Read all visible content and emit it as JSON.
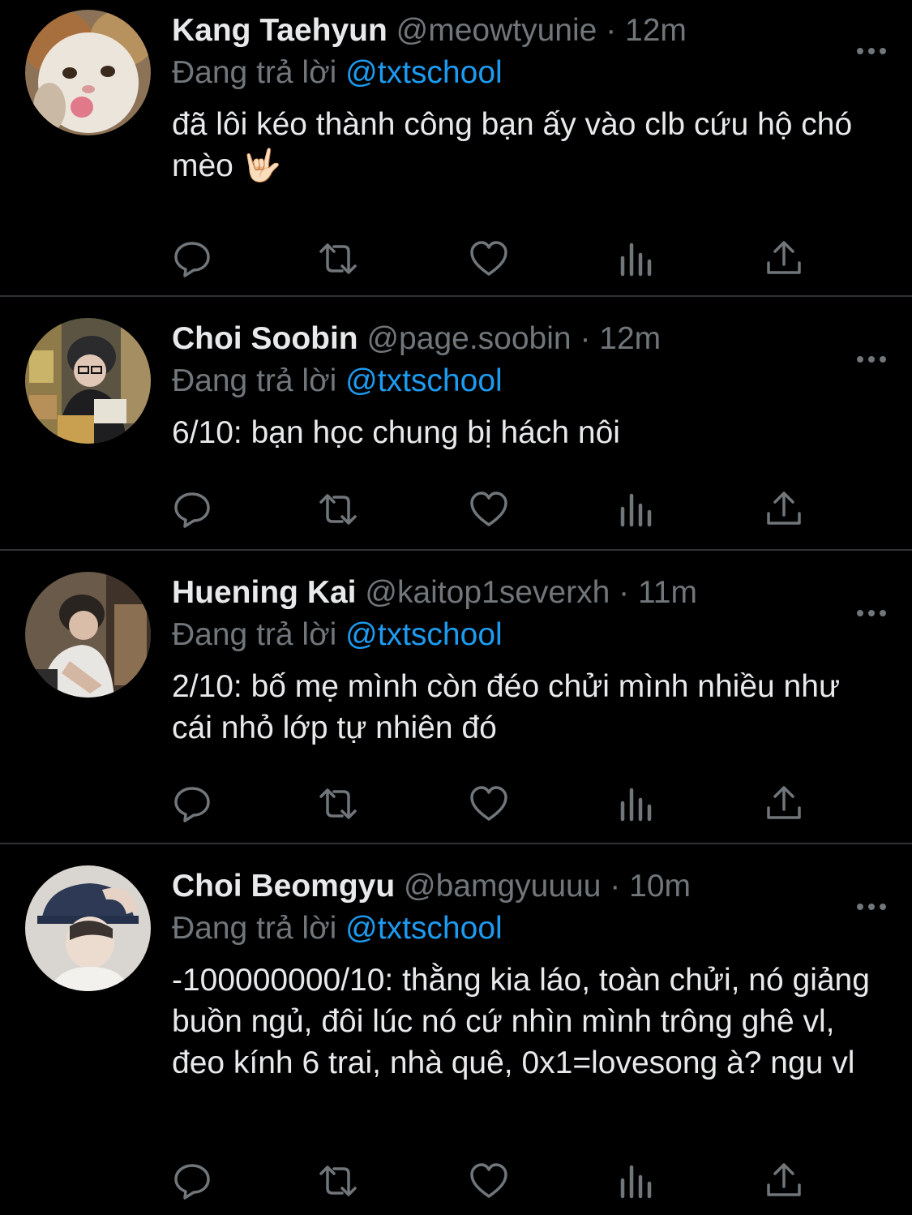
{
  "colors": {
    "background": "#000000",
    "divider": "#2f3336",
    "primary_text": "#e7e9ea",
    "secondary_text": "#71767b",
    "accent": "#1d9bf0"
  },
  "tweets": [
    {
      "name": "Kang Taehyun",
      "handle": "@meowtyunie",
      "separator": "·",
      "time": "12m",
      "reply_prefix": "Đang trả lời",
      "reply_to": "@txtschool",
      "text": "đã lôi kéo thành công bạn ấy vào clb cứu hộ chó mèo 🤟🏻",
      "avatar": "cat-avatar"
    },
    {
      "name": "Choi Soobin",
      "handle": "@page.soobin",
      "separator": "·",
      "time": "12m",
      "reply_prefix": "Đang trả lời",
      "reply_to": "@txtschool",
      "text": "6/10: bạn học chung bị hách nôi",
      "avatar": "person-avatar"
    },
    {
      "name": "Huening Kai",
      "handle": "@kaitop1severxh",
      "separator": "·",
      "time": "11m",
      "reply_prefix": "Đang trả lời",
      "reply_to": "@txtschool",
      "text": "2/10: bố mẹ mình còn đéo chửi mình nhiều như cái nhỏ lớp tự nhiên đó",
      "avatar": "person-avatar"
    },
    {
      "name": "Choi Beomgyu",
      "handle": "@bamgyuuuu",
      "separator": "·",
      "time": "10m",
      "reply_prefix": "Đang trả lời",
      "reply_to": "@txtschool",
      "text": "-100000000/10: thằng kia láo, toàn chửi, nó giảng buồn ngủ, đôi lúc nó cứ nhìn mình trông ghê vl, đeo kính 6 trai, nhà quê, 0x1=lovesong à? ngu vl",
      "avatar": "person-avatar"
    }
  ],
  "action_icons": [
    "reply-icon",
    "retweet-icon",
    "like-icon",
    "views-icon",
    "share-icon"
  ],
  "more_icon": "more-options-icon"
}
